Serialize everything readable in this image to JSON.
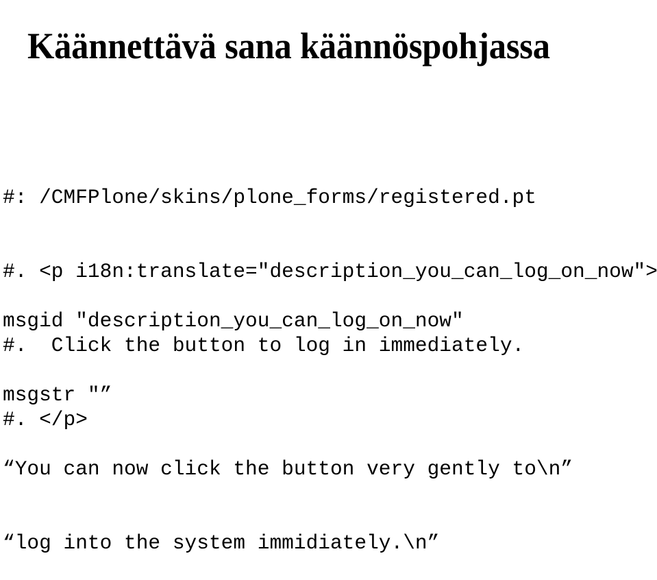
{
  "slide": {
    "title": "Käännettävä sana käännöspohjassa",
    "background_color": "#ffffff",
    "text_color": "#000000"
  },
  "po_file": {
    "comment_lines": [
      "#: /CMFPlone/skins/plone_forms/registered.pt",
      "#. <p i18n:translate=\"description_you_can_log_on_now\">",
      "#.  Click the button to log in immediately.",
      "#. </p>"
    ],
    "message_lines": [
      "msgid \"description_you_can_log_on_now\"",
      "msgstr \"”",
      "“You can now click the button very gently to\\n”",
      "“log into the system immidiately.\\n”"
    ]
  }
}
